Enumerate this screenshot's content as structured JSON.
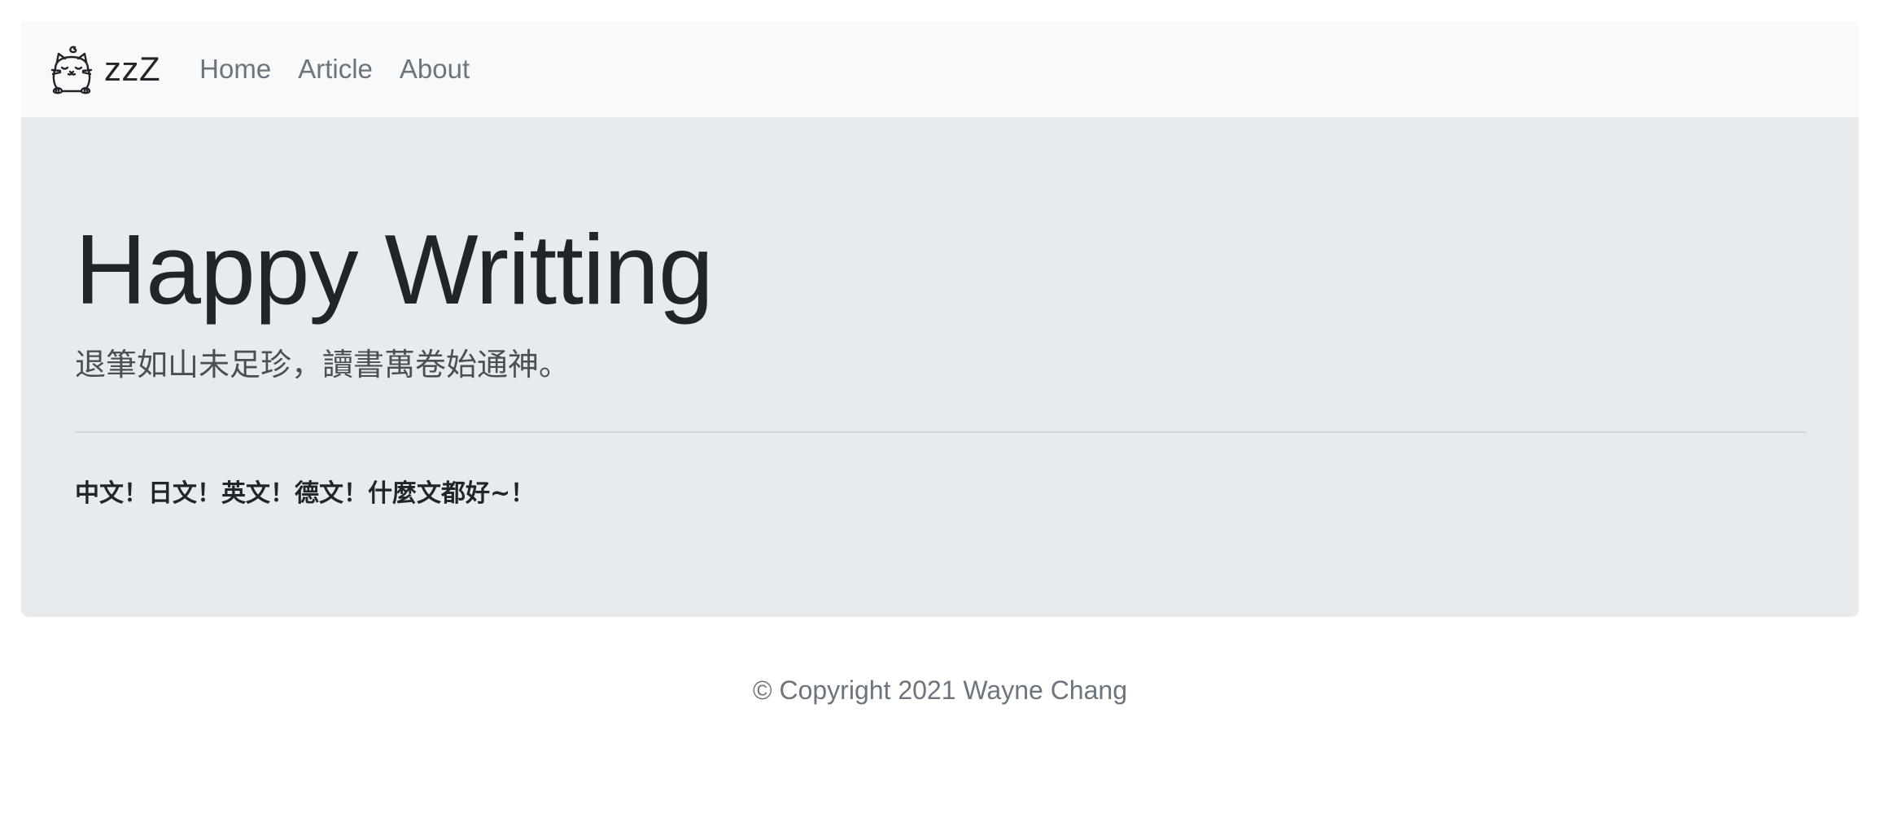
{
  "navbar": {
    "brand": {
      "logo_icon": "sleeping-cat-icon",
      "text": "zzZ"
    },
    "links": [
      {
        "label": "Home"
      },
      {
        "label": "Article"
      },
      {
        "label": "About"
      }
    ]
  },
  "hero": {
    "title": "Happy Writting",
    "subtitle": "退筆如山未足珍，讀書萬卷始通神。",
    "body": "中文！日文！英文！德文！什麼文都好~！"
  },
  "footer": {
    "copyright": "© Copyright 2021 Wayne Chang"
  },
  "colors": {
    "navbar_bg": "#f8f9fa",
    "jumbotron_bg": "#e8ebee",
    "text_dark": "#212529",
    "text_muted": "#6c757d"
  }
}
